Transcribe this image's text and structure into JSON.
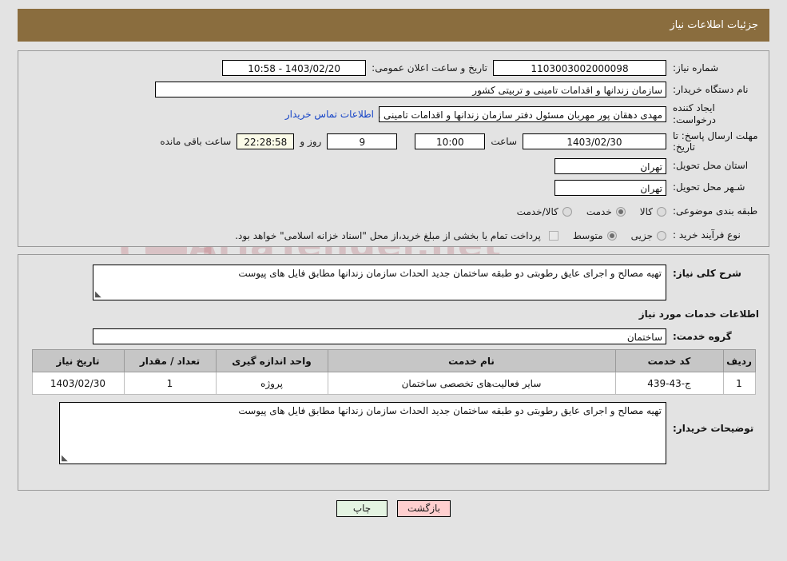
{
  "header": {
    "title": "جزئیات اطلاعات نیاز",
    "bar_color": "#8a6d3e"
  },
  "watermark": {
    "text": "AriaTender.net"
  },
  "info": {
    "need_number_label": "شماره نیاز:",
    "need_number_value": "1103003002000098",
    "publish_label": "تاریخ و ساعت اعلان عمومی:",
    "publish_value": "1403/02/20 - 10:58",
    "buyer_org_label": "نام دستگاه خریدار:",
    "buyer_org_value": "سازمان زندانها و اقدامات تامینی و تربیتی کشور",
    "creator_label": "ایجاد کننده درخواست:",
    "creator_value": "مهدی  دهقان پور مهربان مسئول دفتر سازمان زندانها و اقدامات تامینی و تربیتی",
    "contact_link": "اطلاعات تماس خریدار",
    "deadline_label": "مهلت ارسال پاسخ: تا تاریخ:",
    "deadline_date": "1403/02/30",
    "deadline_hour_label": "ساعت",
    "deadline_time": "10:00",
    "remaining_days": "9",
    "days_and_label": "روز و",
    "remaining_time": "22:28:58",
    "remaining_suffix": "ساعت باقی مانده",
    "province_label": "استان محل تحویل:",
    "province_value": "تهران",
    "city_label": "شـهر محل تحویل:",
    "city_value": "تهران",
    "category_label": "طبقه بندی موضوعی:",
    "category_options": [
      {
        "label": "کالا",
        "selected": false
      },
      {
        "label": "خدمت",
        "selected": true
      },
      {
        "label": "کالا/خدمت",
        "selected": false
      }
    ],
    "process_label": "نوع فرآیند خرید :",
    "process_options": [
      {
        "label": "جزیی",
        "selected": false
      },
      {
        "label": "متوسط",
        "selected": true
      }
    ],
    "treasury_checked": false,
    "treasury_note": "پرداخت تمام یا بخشی از مبلغ خرید،از محل \"اسناد خزانه اسلامی\" خواهد بود."
  },
  "detail": {
    "summary_label": "شرح کلی نیاز:",
    "summary_value": "تهیه مصالح و اجرای عایق رطوبتی دو طبقه ساختمان جدید الحداث سازمان زندانها مطابق فایل های پیوست",
    "services_section_title": "اطلاعات خدمات مورد نیاز",
    "service_group_label": "گروه خدمت:",
    "service_group_value": "ساختمان",
    "table": {
      "columns": [
        "ردیف",
        "کد خدمت",
        "نام خدمت",
        "واحد اندازه گیری",
        "تعداد / مقدار",
        "تاریخ نیاز"
      ],
      "rows": [
        [
          "1",
          "ج-43-439",
          "سایر فعالیت‌های تخصصی ساختمان",
          "پروژه",
          "1",
          "1403/02/30"
        ]
      ]
    },
    "buyer_notes_label": "توضیحات خریدار:",
    "buyer_notes_value": "تهیه مصالح و اجرای عایق رطوبتی دو طبقه ساختمان جدید الحداث سازمان زندانها مطابق فایل های پیوست"
  },
  "footer": {
    "back_label": "بازگشت",
    "print_label": "چاپ"
  }
}
